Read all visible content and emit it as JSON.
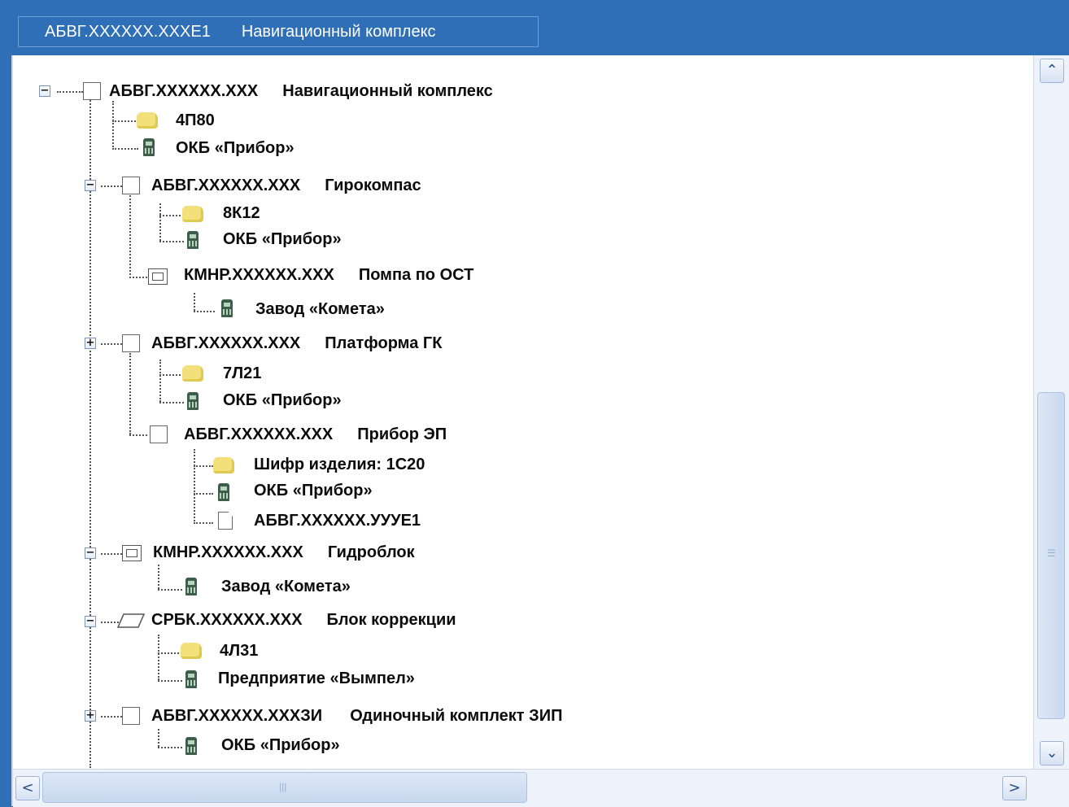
{
  "window": {
    "title_code": "АБВГ.XXXXXX.XXXE1",
    "title_name": "Навигационный комплекс"
  },
  "tree": {
    "root": {
      "code": "АБВГ.XXXXXX.XXX",
      "name": "Навигационный комплекс",
      "expanded": true,
      "icon": "part-box-icon"
    },
    "r_cipher": "4П80",
    "r_org": "ОКБ «Прибор»",
    "gyro": {
      "code": "АБВГ.XXXXXX.XXX",
      "name": "Гирокомпас",
      "expanded": true
    },
    "gyro_cipher": "8К12",
    "gyro_org": "ОКБ «Прибор»",
    "pump": {
      "code": "КМНР.XXXXXX.XXX",
      "name": "Помпа по ОСТ"
    },
    "pump_org": "Завод «Комета»",
    "platform": {
      "code": "АБВГ.XXXXXX.XXX",
      "name": "Платформа ГК",
      "expanded": false
    },
    "platform_cipher": "7Л21",
    "platform_org": "ОКБ «Прибор»",
    "ep": {
      "code": "АБВГ.XXXXXX.XXX",
      "name": "Прибор ЭП"
    },
    "ep_cipher": "Шифр изделия:  1С20",
    "ep_org": "ОКБ «Прибор»",
    "ep_doc": "АБВГ.XXXXXX.УУУЕ1",
    "hydro": {
      "code": "КМНР.XXXXXX.XXX",
      "name": "Гидроблок",
      "expanded": true
    },
    "hydro_org": "Завод «Комета»",
    "corr": {
      "code": "СРБК.XXXXXX.XXX",
      "name": "Блок коррекции",
      "expanded": true
    },
    "corr_cipher": "4Л31",
    "corr_org": "Предприятие «Вымпел»",
    "zip": {
      "code": "АБВГ.XXXXXX.XXXЗИ",
      "name": "Одиночный комплект ЗИП",
      "expanded": false
    },
    "zip_org": "ОКБ «Прибор»"
  },
  "scroll": {
    "expand_minus": "−",
    "expand_plus": "+",
    "up": "⌃",
    "down": "⌄",
    "left": "<",
    "right": ">"
  },
  "colors": {
    "titlebar": "#2f6fb8",
    "panel": "#ffffff",
    "folder": "#f2e07a",
    "org": "#3d5e4a"
  }
}
